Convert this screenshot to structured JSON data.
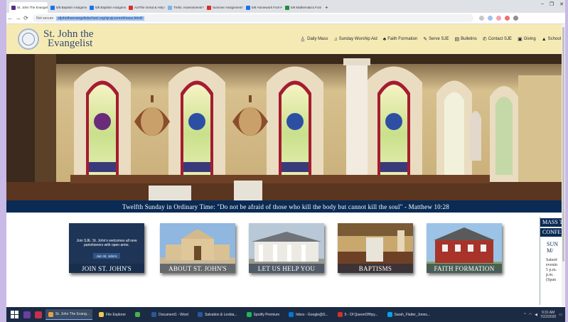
{
  "browser": {
    "tabs": [
      {
        "title": "St. John The Evangelist",
        "color": "#5a2d82",
        "active": true
      },
      {
        "title": "5/8 Baptism Assignment",
        "color": "#1a73e8",
        "active": false
      },
      {
        "title": "5/8 Baptism Assignment",
        "color": "#1a73e8",
        "active": false
      },
      {
        "title": "AoIThe Great & Holy",
        "color": "#d93025",
        "active": false
      },
      {
        "title": "Trello: Assessments",
        "color": "#7fb3e6",
        "active": false
      },
      {
        "title": "Summer Assignment",
        "color": "#d93025",
        "active": false
      },
      {
        "title": "5/8 Homework Form",
        "color": "#1a73e8",
        "active": false
      },
      {
        "title": "5/8 Mathematics Form",
        "color": "#1e8e3e",
        "active": false
      }
    ],
    "new_tab": "+",
    "window_controls": [
      "–",
      "❐",
      "✕"
    ],
    "nav": {
      "back": "←",
      "forward": "→",
      "reload": "⟳"
    },
    "security_label": "Not secure",
    "url": "stjohntheevangelistschool.org/sjcsjcurrent/mass.html#"
  },
  "site": {
    "title_line1": "St. John the",
    "title_line2": "Evangelist",
    "nav": [
      {
        "label": "Daily Mass",
        "icon": "⛪",
        "icon_name": "church-icon"
      },
      {
        "label": "Sunday Worship Aid",
        "icon": "♫",
        "icon_name": "music-note-icon"
      },
      {
        "label": "Faith Formation",
        "icon": "♣",
        "icon_name": "group-icon"
      },
      {
        "label": "Serve SJE",
        "icon": "✎",
        "icon_name": "pen-icon"
      },
      {
        "label": "Bulletins",
        "icon": "▤",
        "icon_name": "bulletin-icon"
      },
      {
        "label": "Contact SJE",
        "icon": "✆",
        "icon_name": "phone-icon"
      },
      {
        "label": "Giving",
        "icon": "▣",
        "icon_name": "giving-icon"
      },
      {
        "label": "School",
        "icon": "▲",
        "icon_name": "school-icon"
      }
    ],
    "banner": "Twelfth Sunday in Ordinary Time: \"Do not be afraid of those who kill the body but cannot kill the soul\" - Matthew 10:28",
    "tiles": [
      {
        "caption": "JOIN ST. JOHN'S",
        "text": "Join SJE. St. John's welcomes all new parishioners with open arms.",
        "button": "Join St. John's"
      },
      {
        "caption": "ABOUT ST. JOHN'S"
      },
      {
        "caption": "LET US HELP YOU"
      },
      {
        "caption": "BAPTISMS"
      },
      {
        "caption": "FAITH FORMATION"
      }
    ],
    "side_panel": {
      "heading1": "MASS T",
      "heading2": "CONFE",
      "sub1": "SUN",
      "sub2": "M/",
      "lines": [
        "Saturd",
        "evenin",
        "5 p.m.",
        "p.m.",
        "(Span"
      ]
    }
  },
  "taskbar": {
    "apps": [
      {
        "label": "St. John The Evang...",
        "color": "#e8a33d",
        "active": true
      },
      {
        "label": "File Explorer",
        "color": "#f2c94c",
        "active": false
      },
      {
        "label": "",
        "color": "#4caf50",
        "active": false
      },
      {
        "label": "Document1 - Word",
        "color": "#2b579a",
        "active": false
      },
      {
        "label": "Salvation & Lesbia...",
        "color": "#2b579a",
        "active": false
      },
      {
        "label": "Spotify Premium",
        "color": "#1db954",
        "active": false
      },
      {
        "label": "Inbox - Google@S...",
        "color": "#0078d4",
        "active": false
      },
      {
        "label": "5 - Of QueenOfHpy...",
        "color": "#d93025",
        "active": false
      },
      {
        "label": "Sarah_Flatter_Jones...",
        "color": "#00a4ef",
        "active": false
      }
    ],
    "time": "9:31 AM",
    "date": "7/22/2020"
  }
}
